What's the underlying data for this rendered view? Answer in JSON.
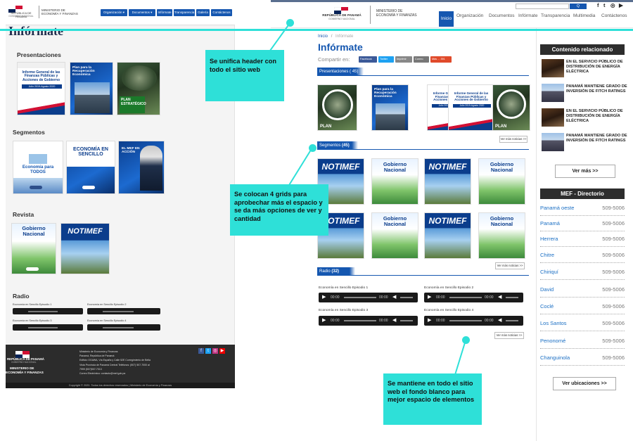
{
  "old": {
    "header": {
      "org_lines": [
        "REPÚBLICA DE PANAMÁ",
        "GOBIERNO NACIONAL"
      ],
      "ministry_lines": [
        "MINISTERIO DE",
        "ECONOMÍA Y FINANZAS"
      ],
      "nav": [
        "Organización",
        "Documentos",
        "Infórmate",
        "Transparencia",
        "Galería",
        "Contáctenos"
      ]
    },
    "page_title": "Infórmate",
    "sections": {
      "presentaciones": "Presentaciones",
      "segmentos": "Segmentos",
      "revista": "Revista",
      "radio": "Radio"
    },
    "present_cards": [
      {
        "title": "Informe General de las Finanzas Públicas y Acciones de Gobierno",
        "sub": "Julio 2019-Agosto 2020"
      },
      {
        "title": "Plan para la Recuperación Económica",
        "sub": ""
      },
      {
        "title": "PLAN ESTRATÉGICO",
        "sub": ""
      }
    ],
    "segment_cards": [
      {
        "title": "Economía para TODOS"
      },
      {
        "title": "ECONOMÍA EN SENCILLO"
      },
      {
        "title": "EL MEF EN ACCIÓN"
      }
    ],
    "revista_cards": [
      {
        "title": "Gobierno Nacional"
      },
      {
        "title": "NOTIMEF"
      }
    ],
    "radio_items": [
      "Economía en Sencillo Episodio 1",
      "Economía en Sencillo Episodio 2",
      "Economía en Sencillo Episodio 3",
      "Economía en Sencillo Episodio 4"
    ],
    "footer": {
      "org": "REPÚBLICA DE PANAMÁ",
      "gov": "GOBIERNO NACIONAL",
      "ministry_1": "MINISTERIO DE",
      "ministry_2": "ECONOMÍA Y FINANZAS",
      "lines": [
        "Ministerio de Economía y Finanzas",
        "Panamá, República de Panamá",
        "Edificio OGAWA, Vía España y Calle 52E Corregimiento de Bella",
        "Vista Provincia de Panamá Central Teléfonos: (507) 507-7000 al",
        "7999 (507)507-7013",
        "Correo Electrónico: contacto@mef.gob.pa"
      ],
      "copyright": "Copyright © 2020. Todos los derechos reservados | Ministerio de Economía y Finanzas"
    }
  },
  "new": {
    "header": {
      "org_lines": [
        "REPÚBLICA DE PANAMÁ",
        "GOBIERNO NACIONAL"
      ],
      "ministry_lines": [
        "MINISTERIO DE",
        "ECONOMÍA Y FINANZAS"
      ],
      "nav": [
        "Inicio",
        "Organización",
        "Documentos",
        "Infórmate",
        "Transparencia",
        "Multimedia",
        "Contáctenos"
      ],
      "search_button": "Q"
    },
    "breadcrumb": {
      "home": "Inicio",
      "sep": "/",
      "current": "Infórmate"
    },
    "page_title": "Infórmate",
    "share_label": "Compartir en:",
    "share_buttons": [
      "Facebook",
      "Twitter",
      "Imprimir",
      "Correo",
      "Más ... 391"
    ],
    "tabs": {
      "presentaciones": "Presentaciones",
      "presentaciones_count": "( 45)",
      "segmentos": "Segmentos",
      "segmentos_count": "(45)",
      "radio": "Radio",
      "radio_count": "(32)"
    },
    "ver_mas": "Ver más noticias >>",
    "present_cards": [
      {
        "title": "PLAN"
      },
      {
        "title": "Plan para la Recuperación Económica"
      },
      {
        "title": "Informe General de las Finanzas Públicas y Acciones de Gobierno",
        "sub": "Julio 2019-Agosto 2020"
      },
      {
        "title": "Informe General de las Finanzas Públicas y Acciones de Gobierno",
        "sub": "Julio 2019-Agosto 2020"
      },
      {
        "title": "PLAN"
      }
    ],
    "grid_cards": [
      "NOTIMEF",
      "Gobierno Nacional",
      "NOTIMEF",
      "Gobierno Nacional",
      "NOTIMEF",
      "Gobierno Nacional",
      "NOTIMEF",
      "Gobierno Nacional"
    ],
    "radio_items": [
      "Economía en Sencillo Episodio 1",
      "Economía en Sencillo Episodio 2",
      "Economía en Sencillo Episodio 3",
      "Economía en Sencillo Episodio 4"
    ],
    "player_time": "00:00",
    "sidebar": {
      "related_title": "Contenido relacionado",
      "related": [
        "EN EL SERVICIO PÚBLICO DE DISTRIBUCIÓN DE ENERGÍA ELÉCTRICA",
        "PANAMÁ MANTIENE GRADO DE INVERSIÓN DE FITCH RATINGS",
        "EN EL SERVICIO PÚBLICO DE DISTRIBUCIÓN DE ENERGÍA ELÉCTRICA",
        "PANAMÁ MANTIENE GRADO DE INVERSIÓN DE FITCH RATINGS"
      ],
      "ver_mas": "Ver más >>",
      "dir_title": "MEF - Directorio",
      "directory": [
        {
          "name": "Panamá oeste",
          "tel": "509-5006"
        },
        {
          "name": "Panamá",
          "tel": "509-5006"
        },
        {
          "name": "Herrera",
          "tel": "509-5006"
        },
        {
          "name": "Chitre",
          "tel": "509-5006"
        },
        {
          "name": "Chiriquí",
          "tel": "509-5006"
        },
        {
          "name": "David",
          "tel": "509-5006"
        },
        {
          "name": "Coclé",
          "tel": "509-5006"
        },
        {
          "name": "Los Santos",
          "tel": "509-5006"
        },
        {
          "name": "Penonomé",
          "tel": "509-5006"
        },
        {
          "name": "Changuinola",
          "tel": "509-5006"
        }
      ],
      "ver_ubicaciones": "Ver ubicaciones >>"
    }
  },
  "annotations": {
    "header_note": "Se unifica header con todo el sitio web",
    "grid_note": "Se colocan 4 grids para aprobechar más el espacio y se da más opciones de ver y cantidad",
    "bg_note": "Se mantiene en todo el sitio web el fondo blanco para mejor espacio de elementos"
  },
  "colors": {
    "accent": "#1557b0",
    "annotation": "#2ee0d8",
    "footer": "#2c2c2c"
  }
}
